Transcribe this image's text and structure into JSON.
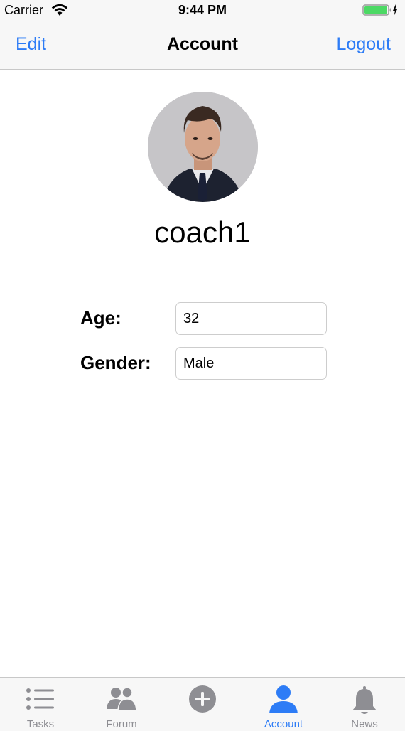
{
  "status_bar": {
    "carrier": "Carrier",
    "time": "9:44 PM",
    "battery_level": 1.0,
    "battery_color": "#4cd964"
  },
  "nav": {
    "edit_label": "Edit",
    "title": "Account",
    "logout_label": "Logout"
  },
  "profile": {
    "username": "coach1"
  },
  "form": {
    "age_label": "Age:",
    "age_value": "32",
    "gender_label": "Gender:",
    "gender_value": "Male"
  },
  "tabs": [
    {
      "label": "Tasks",
      "icon": "list-icon",
      "active": false
    },
    {
      "label": "Forum",
      "icon": "people-icon",
      "active": false
    },
    {
      "label": "",
      "icon": "plus-circle-icon",
      "active": false
    },
    {
      "label": "Account",
      "icon": "person-icon",
      "active": true
    },
    {
      "label": "News",
      "icon": "bell-icon",
      "active": false
    }
  ],
  "colors": {
    "accent": "#2d7cf6",
    "inactive_tab": "#8e8e93",
    "bar_background": "#f7f7f7"
  }
}
